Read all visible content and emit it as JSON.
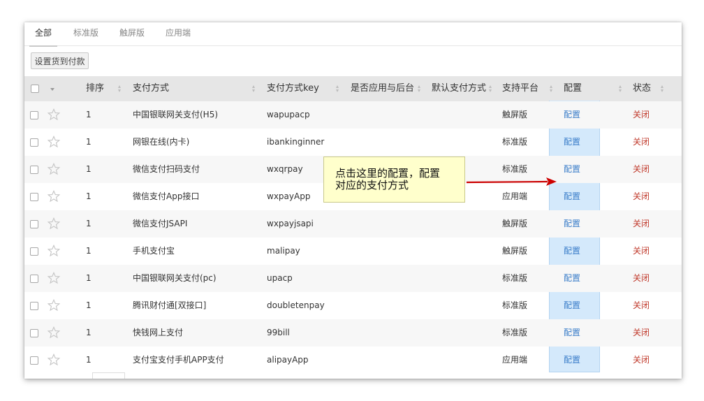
{
  "tabs": [
    "全部",
    "标准版",
    "触屏版",
    "应用端"
  ],
  "toolbar": {
    "cod_button": "设置货到付款"
  },
  "table": {
    "headers": {
      "sort": "排序",
      "method": "支付方式",
      "key": "支付方式key",
      "backend": "是否应用与后台",
      "default": "默认支付方式",
      "platform": "支持平台",
      "config": "配置",
      "status": "状态"
    },
    "rows": [
      {
        "sort": "1",
        "method": "中国银联网关支付(H5)",
        "key": "wapupacp",
        "platform": "触屏版",
        "config": "配置",
        "status": "关闭"
      },
      {
        "sort": "1",
        "method": "网银在线(内卡)",
        "key": "ibankinginner",
        "platform": "标准版",
        "config": "配置",
        "status": "关闭"
      },
      {
        "sort": "1",
        "method": "微信支付扫码支付",
        "key": "wxqrpay",
        "platform": "标准版",
        "config": "配置",
        "status": "关闭"
      },
      {
        "sort": "1",
        "method": "微信支付App接口",
        "key": "wxpayApp",
        "platform": "应用端",
        "config": "配置",
        "status": "关闭"
      },
      {
        "sort": "1",
        "method": "微信支付JSAPI",
        "key": "wxpayjsapi",
        "platform": "触屏版",
        "config": "配置",
        "status": "关闭"
      },
      {
        "sort": "1",
        "method": "手机支付宝",
        "key": "malipay",
        "platform": "触屏版",
        "config": "配置",
        "status": "关闭"
      },
      {
        "sort": "1",
        "method": "中国银联网关支付(pc)",
        "key": "upacp",
        "platform": "标准版",
        "config": "配置",
        "status": "关闭"
      },
      {
        "sort": "1",
        "method": "腾讯财付通[双接口]",
        "key": "doubletenpay",
        "platform": "标准版",
        "config": "配置",
        "status": "关闭"
      },
      {
        "sort": "1",
        "method": "快钱网上支付",
        "key": "99bill",
        "platform": "标准版",
        "config": "配置",
        "status": "关闭"
      },
      {
        "sort": "1",
        "method": "支付宝支付手机APP支付",
        "key": "alipayApp",
        "platform": "应用端",
        "config": "配置",
        "status": "关闭"
      }
    ]
  },
  "annotation": {
    "line1": "点击这里的配置，配置",
    "line2": "对应的支付方式"
  },
  "colors": {
    "config_link": "#3a7dc9",
    "close_link": "#c0392b",
    "highlight": "#d4e9fb",
    "callout_bg": "#ffffcc",
    "arrow": "#cc0000"
  },
  "icons": {
    "star": "star-outline-icon",
    "caret": "caret-down-icon"
  }
}
